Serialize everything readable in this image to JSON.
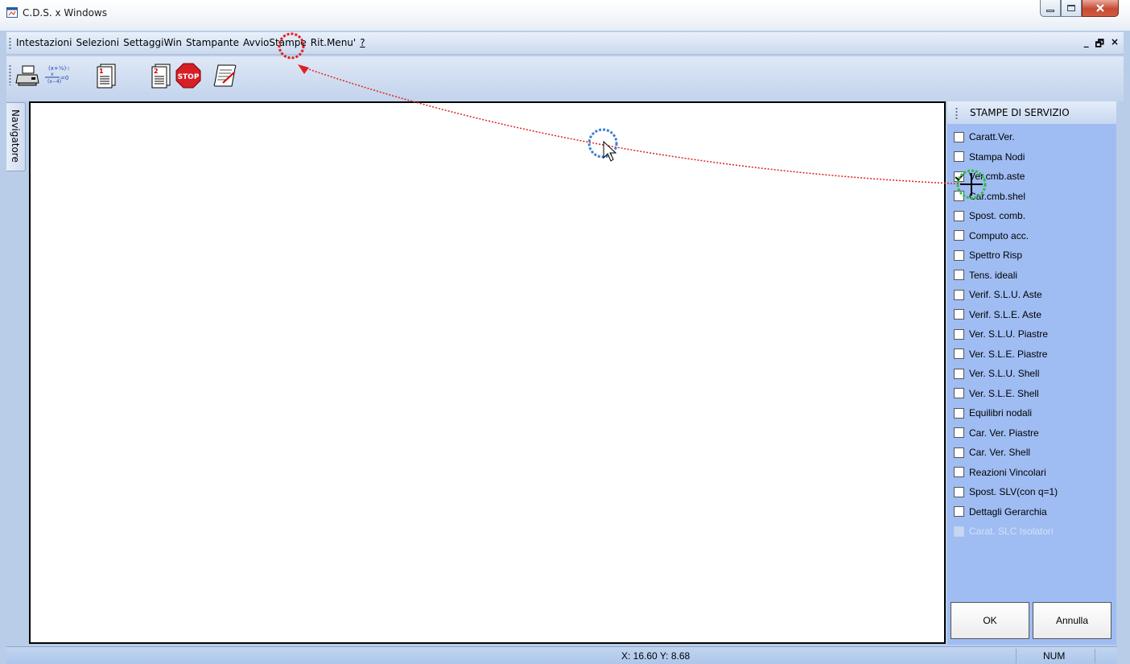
{
  "window": {
    "title": "C.D.S. x Windows",
    "icon": "app-window-icon"
  },
  "menubar": {
    "items": [
      "Intestazioni",
      "Selezioni",
      "SettaggiWin",
      "Stampante",
      "AvvioStampe",
      "Rit.Menu'",
      "?"
    ],
    "mdi_minimize": "_",
    "mdi_restore": "🗗",
    "mdi_close": "×"
  },
  "toolbar": {
    "icons": [
      "printer-icon",
      "formula-icon",
      "page-1-icon",
      "page-2-icon",
      "stop-icon",
      "scroll-edit-icon"
    ],
    "stop_label": "STOP"
  },
  "navigator": {
    "label": "Navigatore"
  },
  "panel": {
    "title": "STAMPE DI SERVIZIO",
    "items": [
      {
        "label": "Caratt.Ver.",
        "checked": false,
        "enabled": true
      },
      {
        "label": "Stampa Nodi",
        "checked": false,
        "enabled": true
      },
      {
        "label": "Ver.cmb.aste",
        "checked": true,
        "enabled": true
      },
      {
        "label": "Car.cmb.shel",
        "checked": false,
        "enabled": true
      },
      {
        "label": "Spost. comb.",
        "checked": false,
        "enabled": true
      },
      {
        "label": "Computo acc.",
        "checked": false,
        "enabled": true
      },
      {
        "label": "Spettro Risp",
        "checked": false,
        "enabled": true
      },
      {
        "label": "Tens. ideali",
        "checked": false,
        "enabled": true
      },
      {
        "label": "Verif. S.L.U. Aste",
        "checked": false,
        "enabled": true
      },
      {
        "label": "Verif. S.L.E. Aste",
        "checked": false,
        "enabled": true
      },
      {
        "label": "Ver. S.L.U. Piastre",
        "checked": false,
        "enabled": true
      },
      {
        "label": "Ver. S.L.E. Piastre",
        "checked": false,
        "enabled": true
      },
      {
        "label": "Ver. S.L.U. Shell",
        "checked": false,
        "enabled": true
      },
      {
        "label": "Ver. S.L.E. Shell",
        "checked": false,
        "enabled": true
      },
      {
        "label": "Equilibri nodali",
        "checked": false,
        "enabled": true
      },
      {
        "label": "Car. Ver. Piastre",
        "checked": false,
        "enabled": true
      },
      {
        "label": "Car. Ver. Shell",
        "checked": false,
        "enabled": true
      },
      {
        "label": "Reazioni Vincolari",
        "checked": false,
        "enabled": true
      },
      {
        "label": "Spost. SLV(con q=1)",
        "checked": false,
        "enabled": true
      },
      {
        "label": "Dettagli Gerarchia",
        "checked": false,
        "enabled": true
      },
      {
        "label": "Carat. SLC Isolatori",
        "checked": false,
        "enabled": false
      }
    ],
    "ok_label": "OK",
    "cancel_label": "Annulla"
  },
  "statusbar": {
    "coords": "X: 16.60  Y: 8.68",
    "num": "NUM"
  },
  "colors": {
    "panel_bg": "#9fbdf3",
    "annotation_red": "#e02020",
    "annotation_blue": "#3f7fd6",
    "annotation_green": "#2fbf3f"
  }
}
